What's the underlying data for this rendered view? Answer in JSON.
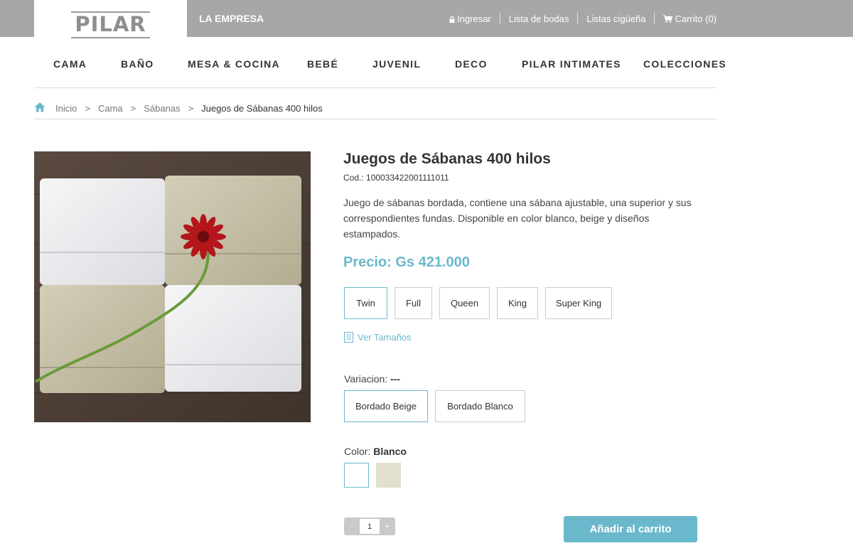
{
  "brand": {
    "logo_text": "PILAR"
  },
  "topbar": {
    "empresa": "LA EMPRESA",
    "links": [
      {
        "label": "Ingresar",
        "icon": "lock-icon"
      },
      {
        "label": "Lista de bodas"
      },
      {
        "label": "Listas cigüeña"
      },
      {
        "label": "Carrito (0)",
        "icon": "cart-icon"
      }
    ]
  },
  "nav": {
    "items": [
      {
        "label": "CAMA"
      },
      {
        "label": "BAÑO"
      },
      {
        "label": "MESA & COCINA"
      },
      {
        "label": "BEBÉ"
      },
      {
        "label": "JUVENIL"
      },
      {
        "label": "DECO"
      },
      {
        "label": "PILAR INTIMATES"
      },
      {
        "label": "COLECCIONES"
      }
    ]
  },
  "breadcrumb": {
    "home_icon": "home-icon",
    "items": [
      "Inicio",
      "Cama",
      "Sábanas"
    ],
    "separator": ">",
    "current": "Juegos de Sábanas 400 hilos"
  },
  "product": {
    "title": "Juegos de Sábanas 400 hilos",
    "code": "Cod.: 100033422001111011",
    "description": "Juego de sábanas bordada, contiene una sábana ajustable, una superior y sus correspondientes fundas. Disponible en color blanco, beige y diseños estampados.",
    "price": "Precio: Gs 421.000",
    "sizes": [
      {
        "label": "Twin",
        "selected": true
      },
      {
        "label": "Full",
        "selected": false
      },
      {
        "label": "Queen",
        "selected": false
      },
      {
        "label": "King",
        "selected": false
      },
      {
        "label": "Super King",
        "selected": false
      }
    ],
    "ver_tamanos": "Ver Tamaños",
    "variacion_label": "Variacion:",
    "variacion_value": "---",
    "variations": [
      {
        "label": "Bordado Beige",
        "selected": true
      },
      {
        "label": "Bordado Blanco",
        "selected": false
      }
    ],
    "color_label": "Color:",
    "color_value": "Blanco",
    "colors": [
      {
        "name": "white",
        "hex": "#ffffff",
        "selected": true
      },
      {
        "name": "beige",
        "hex": "#e2dfcf",
        "selected": false
      }
    ],
    "quantity": {
      "minus": "-",
      "value": "1",
      "plus": "+"
    },
    "add_to_cart": "Añadir al carrito"
  },
  "colors": {
    "accent": "#6ab8cc",
    "topbar": "#a7a7a9"
  }
}
